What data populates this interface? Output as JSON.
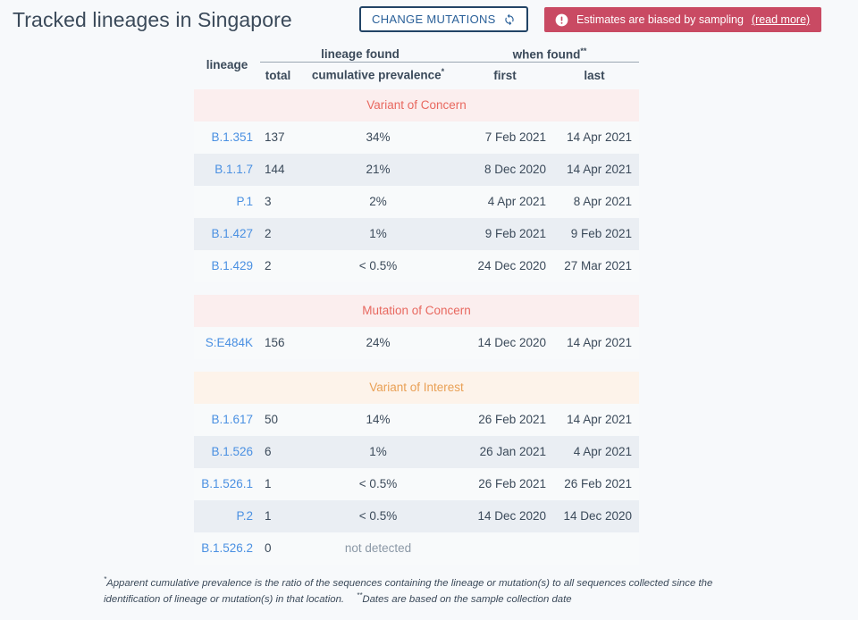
{
  "header": {
    "title": "Tracked lineages in Singapore",
    "change_mutations_label": "CHANGE MUTATIONS",
    "sync_icon": "sync-icon",
    "banner": {
      "icon": "exclamation-circle-icon",
      "text": "Estimates are biased by sampling",
      "read_more": "(read more)",
      "color": "#c94a63"
    }
  },
  "table": {
    "columns": {
      "lineage": "lineage",
      "group_lineage_found": "lineage found",
      "group_when_found": "when found",
      "group_when_found_mark": "**",
      "total": "total",
      "cumulative_prevalence": "cumulative prevalence",
      "cumulative_prevalence_mark": "*",
      "first": "first",
      "last": "last"
    },
    "sections": [
      {
        "title": "Variant of Concern",
        "kind": "concern",
        "color": "#e8685f",
        "background": "#fbeeee",
        "rows": [
          {
            "lineage": "B.1.351",
            "total": "137",
            "prevalence": "34%",
            "first": "7 Feb 2021",
            "last": "14 Apr 2021"
          },
          {
            "lineage": "B.1.1.7",
            "total": "144",
            "prevalence": "21%",
            "first": "8 Dec 2020",
            "last": "14 Apr 2021"
          },
          {
            "lineage": "P.1",
            "total": "3",
            "prevalence": "2%",
            "first": "4 Apr 2021",
            "last": "8 Apr 2021"
          },
          {
            "lineage": "B.1.427",
            "total": "2",
            "prevalence": "1%",
            "first": "9 Feb 2021",
            "last": "9 Feb 2021"
          },
          {
            "lineage": "B.1.429",
            "total": "2",
            "prevalence": "< 0.5%",
            "first": "24 Dec 2020",
            "last": "27 Mar 2021"
          }
        ]
      },
      {
        "title": "Mutation of Concern",
        "kind": "concern",
        "color": "#e8685f",
        "background": "#fbeeee",
        "rows": [
          {
            "lineage": "S:E484K",
            "total": "156",
            "prevalence": "24%",
            "first": "14 Dec 2020",
            "last": "14 Apr 2021"
          }
        ]
      },
      {
        "title": "Variant of Interest",
        "kind": "interest",
        "color": "#e9a055",
        "background": "#fdf3ea",
        "rows": [
          {
            "lineage": "B.1.617",
            "total": "50",
            "prevalence": "14%",
            "first": "26 Feb 2021",
            "last": "14 Apr 2021"
          },
          {
            "lineage": "B.1.526",
            "total": "6",
            "prevalence": "1%",
            "first": "26 Jan 2021",
            "last": "4 Apr 2021"
          },
          {
            "lineage": "B.1.526.1",
            "total": "1",
            "prevalence": "< 0.5%",
            "first": "26 Feb 2021",
            "last": "26 Feb 2021"
          },
          {
            "lineage": "P.2",
            "total": "1",
            "prevalence": "< 0.5%",
            "first": "14 Dec 2020",
            "last": "14 Dec 2020"
          },
          {
            "lineage": "B.1.526.2",
            "total": "0",
            "prevalence": "not detected",
            "first": "",
            "last": "",
            "not_detected": true
          }
        ]
      }
    ]
  },
  "footnotes": {
    "mark_one": "*",
    "text_one": "Apparent cumulative prevalence is the ratio of the sequences containing the lineage or mutation(s) to all sequences collected since the identification of lineage or mutation(s) in that location.",
    "mark_two": "**",
    "text_two": "Dates are based on the sample collection date"
  }
}
